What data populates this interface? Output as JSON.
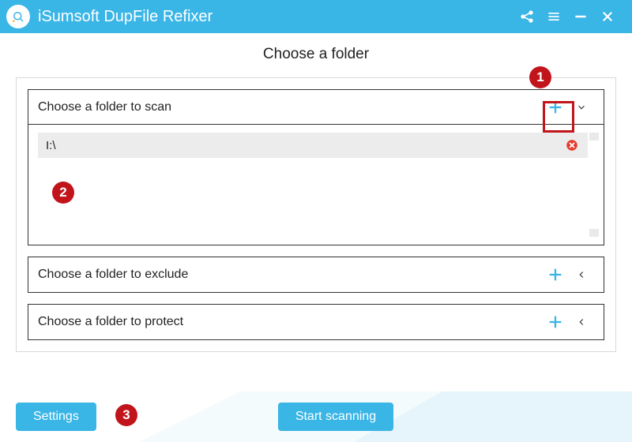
{
  "app": {
    "title": "iSumsoft DupFile Refixer"
  },
  "page": {
    "title": "Choose a folder"
  },
  "sections": {
    "scan": {
      "label": "Choose a folder to scan",
      "expanded": true
    },
    "exclude": {
      "label": "Choose a folder to exclude",
      "expanded": false
    },
    "protect": {
      "label": "Choose a folder to protect",
      "expanded": false
    }
  },
  "scan_folders": [
    {
      "path": "I:\\"
    }
  ],
  "buttons": {
    "settings": "Settings",
    "start": "Start scanning"
  },
  "callouts": {
    "one": "1",
    "two": "2",
    "three": "3"
  }
}
